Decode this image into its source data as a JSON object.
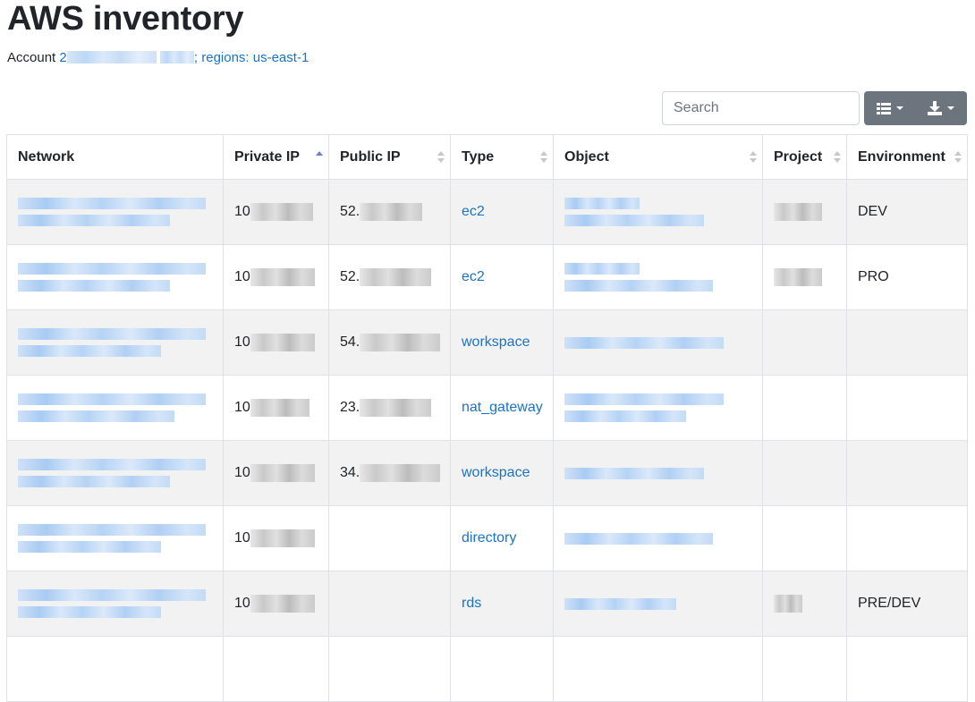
{
  "page": {
    "title": "AWS inventory",
    "account_prefix": "Account ",
    "account_id": "2",
    "regions_label": "; regions: us-east-1"
  },
  "toolbar": {
    "search_placeholder": "Search",
    "columns_icon": "list-columns-icon",
    "export_icon": "download-icon"
  },
  "table": {
    "columns": [
      "Network",
      "Private IP",
      "Public IP",
      "Type",
      "Object",
      "Project",
      "Environment"
    ],
    "sorted_column": "Private IP",
    "sort_direction": "asc",
    "rows": [
      {
        "private_ip": "10",
        "public_ip": "52.",
        "type": "ec2",
        "environment": "DEV"
      },
      {
        "private_ip": "10",
        "public_ip": "52.",
        "type": "ec2",
        "environment": "PRO"
      },
      {
        "private_ip": "10",
        "public_ip": "54.",
        "type": "workspace",
        "environment": ""
      },
      {
        "private_ip": "10",
        "public_ip": "23.",
        "type": "nat_gateway",
        "environment": ""
      },
      {
        "private_ip": "10",
        "public_ip": "34.",
        "type": "workspace",
        "environment": ""
      },
      {
        "private_ip": "10",
        "public_ip": "",
        "type": "directory",
        "environment": ""
      },
      {
        "private_ip": "10",
        "public_ip": "",
        "type": "rds",
        "environment": "PRE/DEV"
      },
      {
        "private_ip": "",
        "public_ip": "",
        "type": "",
        "environment": ""
      }
    ]
  },
  "colors": {
    "link": "#1a73c7",
    "button": "#6c757d",
    "stripe": "#f2f2f2",
    "sort_active": "#6f7fcf"
  }
}
